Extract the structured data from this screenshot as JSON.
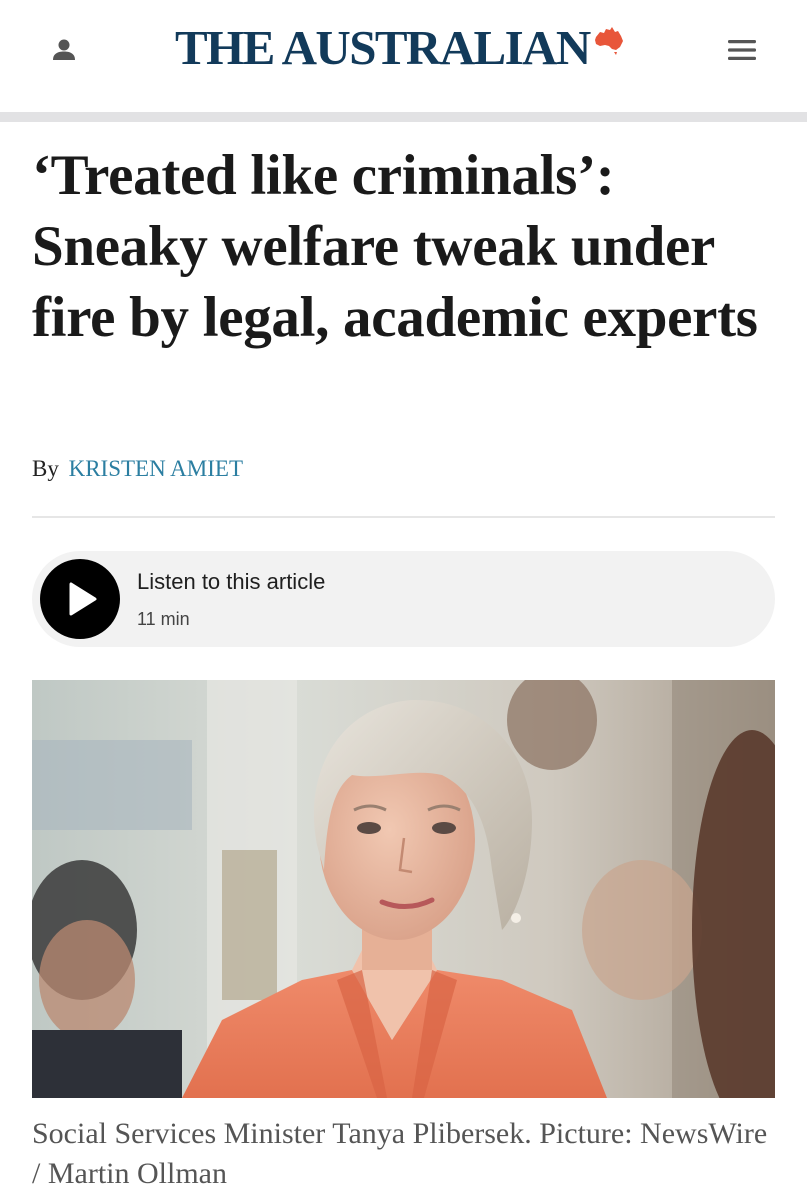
{
  "header": {
    "masthead": "THE AUSTRALIAN",
    "user_icon": "user-icon",
    "menu_icon": "hamburger-menu-icon",
    "brand_color": "#123a5a",
    "map_color": "#e8563a"
  },
  "article": {
    "headline": "‘Treated like criminals’: Sneaky welfare tweak under fire by legal, academic experts",
    "byline_prefix": "By",
    "author": "KRISTEN AMIET",
    "author_color": "#2b7ea1"
  },
  "audio": {
    "title": "Listen to this article",
    "duration": "11 min",
    "icon": "play-icon"
  },
  "image": {
    "caption": "Social Services Minister Tanya Plibersek. Picture: NewsWire / Martin Ollman"
  }
}
